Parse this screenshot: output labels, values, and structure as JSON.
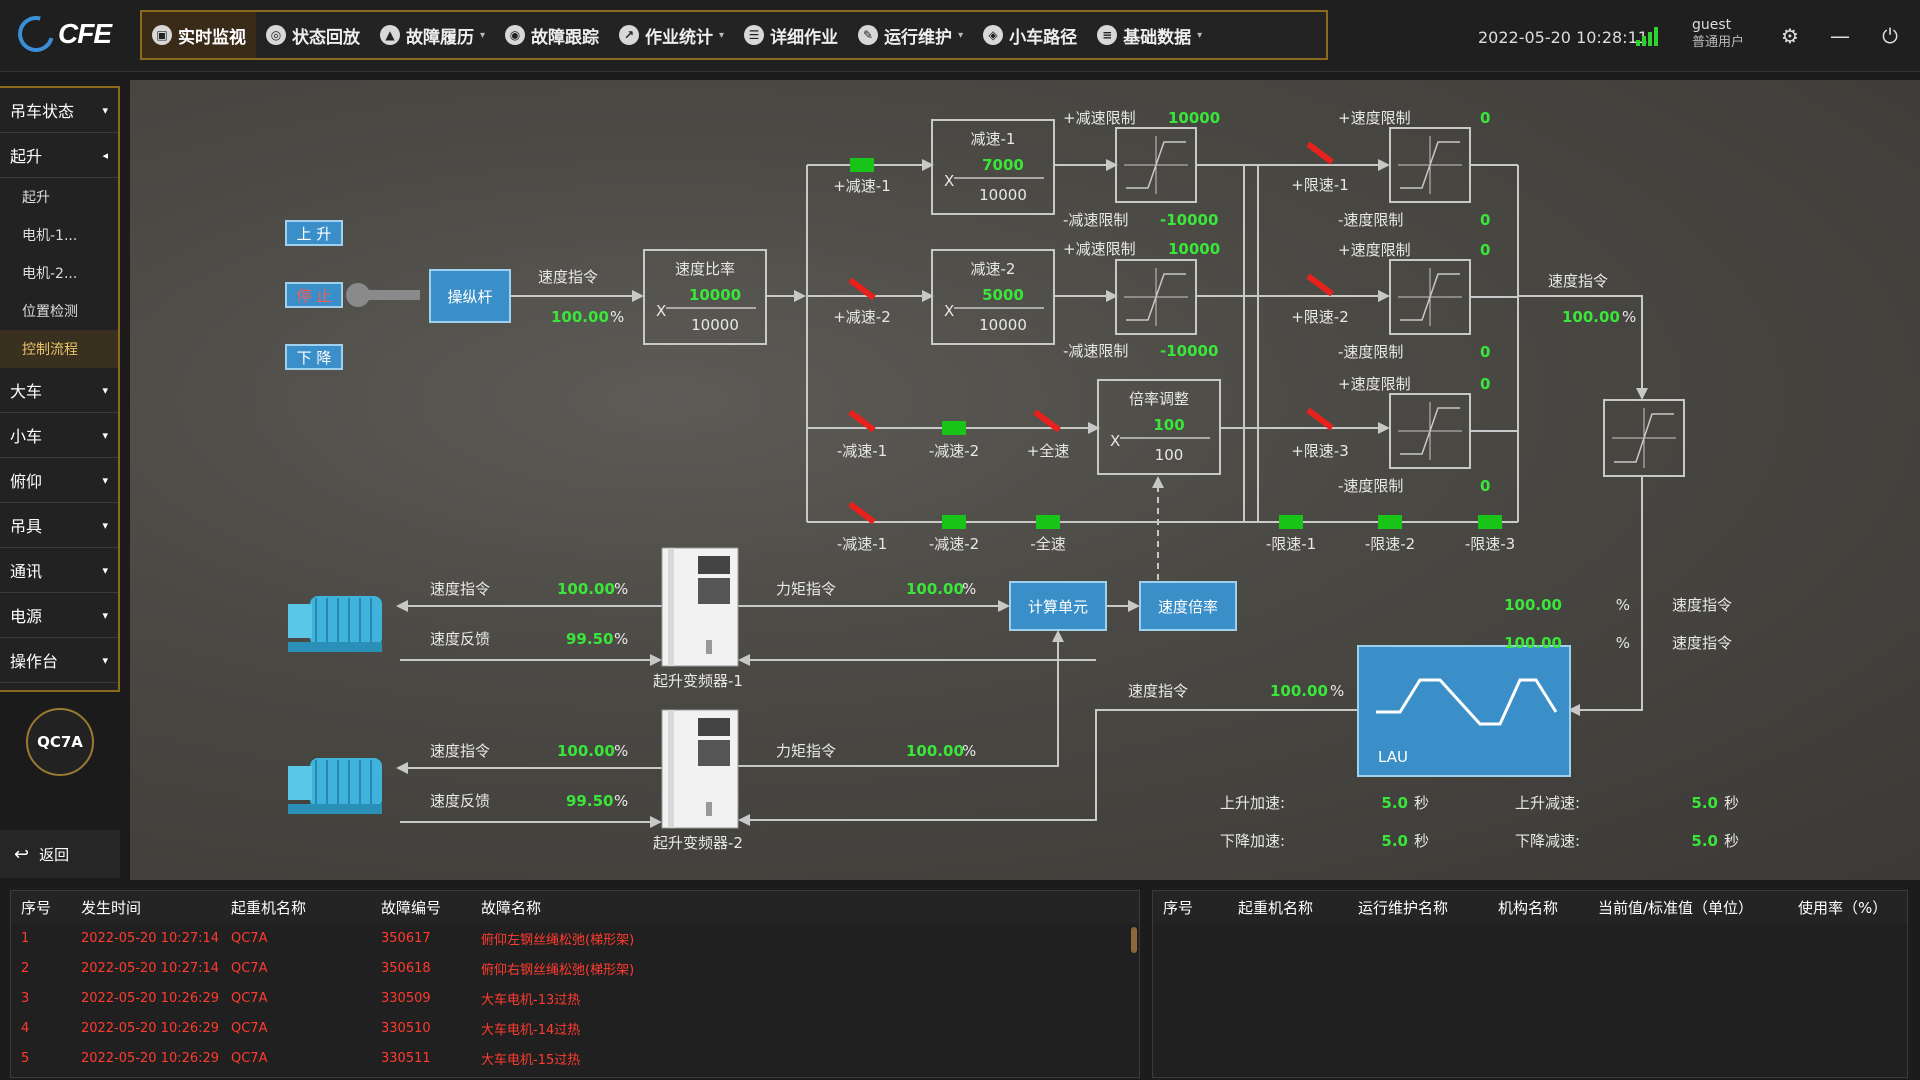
{
  "app": {
    "logo_text": "CFE"
  },
  "nav": {
    "items": [
      {
        "label": "实时监视",
        "icon": "monitor-icon",
        "active": true
      },
      {
        "label": "状态回放",
        "icon": "replay-icon"
      },
      {
        "label": "故障履历",
        "icon": "warning-icon",
        "caret": true
      },
      {
        "label": "故障跟踪",
        "icon": "location-icon"
      },
      {
        "label": "作业统计",
        "icon": "chart-icon",
        "caret": true
      },
      {
        "label": "详细作业",
        "icon": "list-icon"
      },
      {
        "label": "运行维护",
        "icon": "wrench-icon",
        "caret": true
      },
      {
        "label": "小车路径",
        "icon": "path-icon"
      },
      {
        "label": "基础数据",
        "icon": "database-icon",
        "caret": true
      }
    ]
  },
  "header": {
    "datetime": "2022-05-20 10:28:11",
    "user_name": "guest",
    "user_role": "普通用户"
  },
  "sidebar": {
    "items": [
      {
        "label": "吊车状态",
        "expanded": false
      },
      {
        "label": "起升",
        "expanded": true,
        "children": [
          "起升",
          "电机-1...",
          "电机-2...",
          "位置检测",
          "控制流程"
        ],
        "active_child": 4
      },
      {
        "label": "大车"
      },
      {
        "label": "小车"
      },
      {
        "label": "俯仰"
      },
      {
        "label": "吊具"
      },
      {
        "label": "通讯"
      },
      {
        "label": "电源"
      },
      {
        "label": "操作台"
      }
    ],
    "badge": "QC7A",
    "back_label": "返回"
  },
  "diagram": {
    "lever": {
      "up": "上 升",
      "stop": "停 止",
      "down": "下 降",
      "lever_label": "操纵杆"
    },
    "speed_cmd_label": "速度指令",
    "speed_cmd_value": "100.00",
    "percent": "%",
    "ratio": {
      "title": "速度比率",
      "num": "10000",
      "den": "10000",
      "x": "X"
    },
    "decel1": {
      "title": "减速-1",
      "num": "7000",
      "den": "10000"
    },
    "decel2": {
      "title": "减速-2",
      "num": "5000",
      "den": "10000"
    },
    "rate_adj": {
      "title": "倍率调整",
      "num": "100",
      "den": "100"
    },
    "limits": {
      "plus_decel_limit": "+减速限制",
      "minus_decel_limit": "-减速限制",
      "plus_speed_limit": "+速度限制",
      "minus_speed_limit": "-速度限制",
      "v10000": "10000",
      "vm10000": "-10000",
      "v0": "0"
    },
    "switch_labels": {
      "pd1": "+减速-1",
      "pd2": "+减速-2",
      "md1": "-减速-1",
      "md2": "-减速-2",
      "full_p": "+全速",
      "full_m": "-全速",
      "pl1": "+限速-1",
      "pl2": "+限速-2",
      "pl3": "+限速-3",
      "ml1": "-限速-1",
      "ml2": "-限速-2",
      "ml3": "-限速-3"
    },
    "drive1": {
      "speed_cmd": "速度指令",
      "speed_cmd_val": "100.00",
      "speed_fb": "速度反馈",
      "speed_fb_val": "99.50",
      "torque_cmd": "力矩指令",
      "torque_val": "100.00",
      "name": "起升变频器-1"
    },
    "drive2": {
      "speed_cmd": "速度指令",
      "speed_cmd_val": "100.00",
      "speed_fb": "速度反馈",
      "speed_fb_val": "99.50",
      "torque_cmd": "力矩指令",
      "torque_val": "100.00",
      "name": "起升变频器-2"
    },
    "calc_unit": "计算单元",
    "speed_rate": "速度倍率",
    "right": {
      "speed_cmd": "速度指令",
      "speed_cmd_val": "100.00",
      "out1_val": "100.00",
      "out1_label": "速度指令",
      "out2_val": "100.00",
      "out2_label": "速度指令",
      "lau_speed_label": "速度指令",
      "lau_speed_val": "100.00"
    },
    "lau": {
      "label": "LAU"
    },
    "ramps": {
      "up_acc": "上升加速:",
      "up_acc_val": "5.0",
      "down_acc": "下降加速:",
      "down_acc_val": "5.0",
      "up_dec": "上升减速:",
      "up_dec_val": "5.0",
      "down_dec": "下降减速:",
      "down_dec_val": "5.0",
      "unit": "秒"
    },
    "colors": {
      "green": "#18c418",
      "red": "#e8211c",
      "blue": "#3b8fc8",
      "value": "#39e639"
    }
  },
  "fault_table": {
    "headers": [
      "序号",
      "发生时间",
      "起重机名称",
      "故障编号",
      "故障名称"
    ],
    "rows": [
      [
        "1",
        "2022-05-20 10:27:14",
        "QC7A",
        "350617",
        "俯仰左钢丝绳松弛(梯形架)"
      ],
      [
        "2",
        "2022-05-20 10:27:14",
        "QC7A",
        "350618",
        "俯仰右钢丝绳松弛(梯形架)"
      ],
      [
        "3",
        "2022-05-20 10:26:29",
        "QC7A",
        "330509",
        "大车电机-13过热"
      ],
      [
        "4",
        "2022-05-20 10:26:29",
        "QC7A",
        "330510",
        "大车电机-14过热"
      ],
      [
        "5",
        "2022-05-20 10:26:29",
        "QC7A",
        "330511",
        "大车电机-15过热"
      ]
    ]
  },
  "maint_table": {
    "headers": [
      "序号",
      "起重机名称",
      "运行维护名称",
      "机构名称",
      "当前值/标准值（单位）",
      "使用率（%）"
    ]
  }
}
